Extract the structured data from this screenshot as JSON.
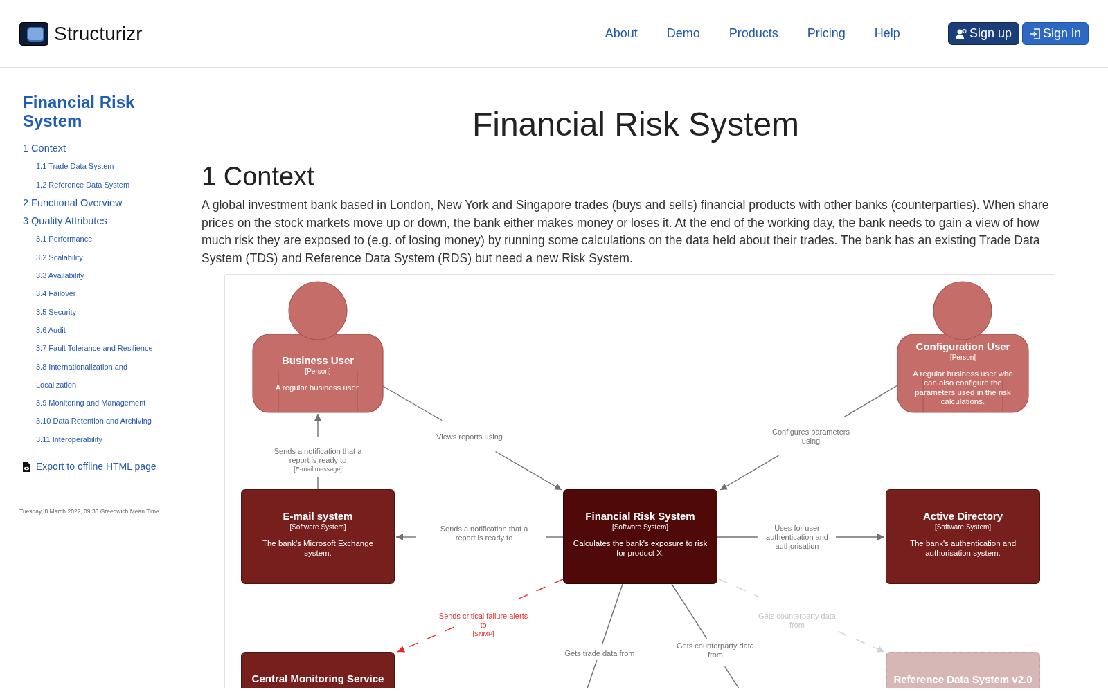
{
  "header": {
    "logo": "Structurizr",
    "nav": [
      "About",
      "Demo",
      "Products",
      "Pricing",
      "Help"
    ],
    "buttons": [
      {
        "label": "Sign up",
        "kind": "signup"
      },
      {
        "label": "Sign in",
        "kind": "signin"
      }
    ]
  },
  "sidebar": {
    "title": "Financial Risk System",
    "items": [
      {
        "label": "1 Context",
        "children": [
          {
            "label": "1.1 Trade Data System"
          },
          {
            "label": "1.2 Reference Data System"
          }
        ]
      },
      {
        "label": "2 Functional Overview"
      },
      {
        "label": "3 Quality Attributes",
        "children": [
          {
            "label": "3.1 Performance"
          },
          {
            "label": "3.2 Scalability"
          },
          {
            "label": "3.3 Availability"
          },
          {
            "label": "3.4 Failover"
          },
          {
            "label": "3.5 Security"
          },
          {
            "label": "3.6 Audit"
          },
          {
            "label": "3.7 Fault Tolerance and Resilience"
          },
          {
            "label": "3.8 Internationalization and Localization"
          },
          {
            "label": "3.9 Monitoring and Management"
          },
          {
            "label": "3.10 Data Retention and Archiving"
          },
          {
            "label": "3.11 Interoperability"
          }
        ]
      }
    ],
    "export_link": "Export to offline HTML page",
    "timestamp": "Tuesday, 8 March 2022, 09:36 Greenwich Mean Time"
  },
  "main": {
    "title": "Financial Risk System",
    "section": {
      "heading": "1 Context",
      "paragraph": "A global investment bank based in London, New York and Singapore trades (buys and sells) financial products with other banks (counterparties). When share prices on the stock markets move up or down, the bank either makes money or loses it. At the end of the working day, the bank needs to gain a view of how much risk they are exposed to (e.g. of losing money) by running some calculations on the data held about their trades. The bank has an existing Trade Data System (TDS) and Reference Data System (RDS) but need a new Risk System."
    },
    "diagram": {
      "nodes": [
        {
          "name": "Business User",
          "type": "[Person]",
          "description": "A regular business user.",
          "kind": "person",
          "color": "#c56d69"
        },
        {
          "name": "Configuration User",
          "type": "[Person]",
          "description": "A regular business user who can also configure the parameters used in the risk calculations.",
          "kind": "person",
          "color": "#c56d69"
        },
        {
          "name": "E-mail system",
          "type": "[Software System]",
          "description": "The bank's Microsoft Exchange system.",
          "kind": "system",
          "color": "#761f1d"
        },
        {
          "name": "Financial Risk System",
          "type": "[Software System]",
          "description": "Calculates the bank's exposure to risk for product X.",
          "kind": "system",
          "color": "#4e0908"
        },
        {
          "name": "Active Directory",
          "type": "[Software System]",
          "description": "The bank's authentication and authorisation system.",
          "kind": "system",
          "color": "#761f1d"
        },
        {
          "name": "Central Monitoring Service",
          "kind": "system",
          "color": "#761f1d"
        },
        {
          "name": "Reference Data System v2.0",
          "kind": "system-dashed",
          "color": "#d7b6b6"
        }
      ],
      "edges": [
        {
          "description": "Views reports using",
          "kind": "solid"
        },
        {
          "description": "Configures parameters using",
          "kind": "solid"
        },
        {
          "description": "Sends a notification that a report is ready to",
          "technology": "[E-mail message]",
          "kind": "solid"
        },
        {
          "description": "Sends a notification that a report is ready to",
          "kind": "solid"
        },
        {
          "description": "Uses for user authentication and authorisation",
          "kind": "solid"
        },
        {
          "description": "Sends critical failure alerts to",
          "technology": "[SNMP]",
          "kind": "alert"
        },
        {
          "description": "Gets counterparty data from",
          "kind": "faded"
        },
        {
          "description": "Gets trade data from",
          "kind": "solid"
        },
        {
          "description": "Gets counterparty data from",
          "kind": "solid"
        }
      ]
    }
  }
}
